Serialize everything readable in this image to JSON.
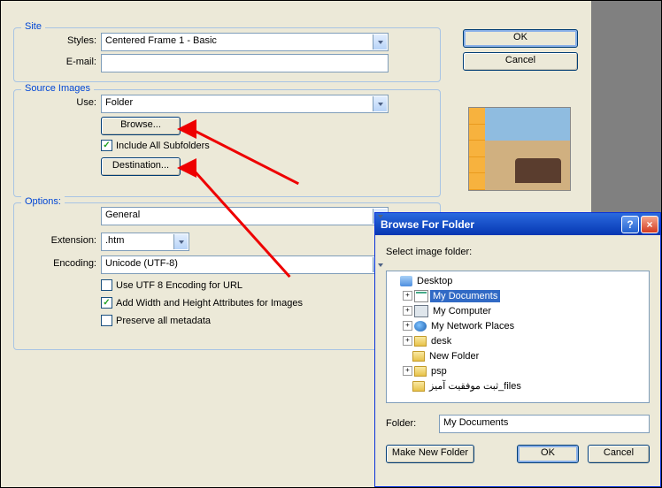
{
  "buttons": {
    "ok": "OK",
    "cancel": "Cancel"
  },
  "site": {
    "legend": "Site",
    "styles_label": "Styles:",
    "styles_value": "Centered Frame 1 - Basic",
    "email_label": "E-mail:",
    "email_value": ""
  },
  "source": {
    "legend": "Source Images",
    "use_label": "Use:",
    "use_value": "Folder",
    "browse_btn": "Browse...",
    "include_subfolders": "Include All Subfolders",
    "destination_btn": "Destination..."
  },
  "options": {
    "label": "Options:",
    "value": "General",
    "extension_label": "Extension:",
    "extension_value": ".htm",
    "encoding_label": "Encoding:",
    "encoding_value": "Unicode (UTF-8)",
    "utf8_url": "Use UTF 8 Encoding for URL",
    "add_wh": "Add Width and Height Attributes for Images",
    "preserve_meta": "Preserve all metadata"
  },
  "browse_dlg": {
    "title": "Browse For Folder",
    "prompt": "Select image folder:",
    "folder_label": "Folder:",
    "folder_value": "My Documents",
    "make_new": "Make New Folder",
    "ok": "OK",
    "cancel": "Cancel",
    "tree": {
      "desktop": "Desktop",
      "mydocs": "My Documents",
      "mycomp": "My Computer",
      "mynet": "My Network Places",
      "desk": "desk",
      "newfolder": "New Folder",
      "psp": "psp",
      "arabic": "ثبت موفقيت آميز_files"
    }
  }
}
